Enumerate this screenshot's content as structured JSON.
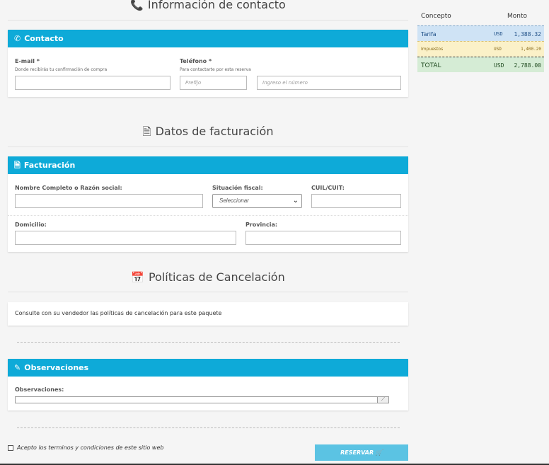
{
  "contact_section": {
    "title": "Información de contacto",
    "panel_title": "Contacto",
    "email_label": "E-mail *",
    "email_hint": "Donde recibirás tu confirmación de compra",
    "phone_label": "Teléfono *",
    "phone_hint": "Para contactarte por esta reserva",
    "prefix_placeholder": "Prefijo",
    "number_placeholder": "Ingreso el número"
  },
  "billing_section": {
    "title": "Datos de facturación",
    "panel_title": "Facturación",
    "name_label": "Nombre Completo o Razón social:",
    "tax_label": "Situación fiscal:",
    "tax_select": "Seleccionar",
    "cuit_label": "CUIL/CUIT:",
    "address_label": "Domicilio:",
    "province_label": "Provincia:"
  },
  "cancel_section": {
    "title": "Políticas de Cancelación",
    "text": "Consulte con su vendedor las políticas de cancelación para este paquete"
  },
  "obs_section": {
    "panel_title": "Observaciones",
    "label": "Observaciones:"
  },
  "terms_text": "Acepto los terminos y condiciones de este sitio web",
  "reserve_button": "RESERVAR",
  "summary": {
    "col_concept": "Concepto",
    "col_amount": "Monto",
    "rows": [
      {
        "concept": "Tarifa",
        "currency": "USD",
        "amount": "1,388.32"
      },
      {
        "concept": "Impuestos",
        "currency": "USD",
        "amount": "1,400.20"
      },
      {
        "concept": "TOTAL",
        "currency": "USD",
        "amount": "2,788.00"
      }
    ]
  },
  "colors": {
    "panel_header": "#0eaad8",
    "button": "#5bc3e3"
  },
  "icons": [
    "phone-icon",
    "document-icon",
    "calendar-x-icon",
    "edit-icon",
    "cart-icon",
    "chevron-down-icon"
  ]
}
